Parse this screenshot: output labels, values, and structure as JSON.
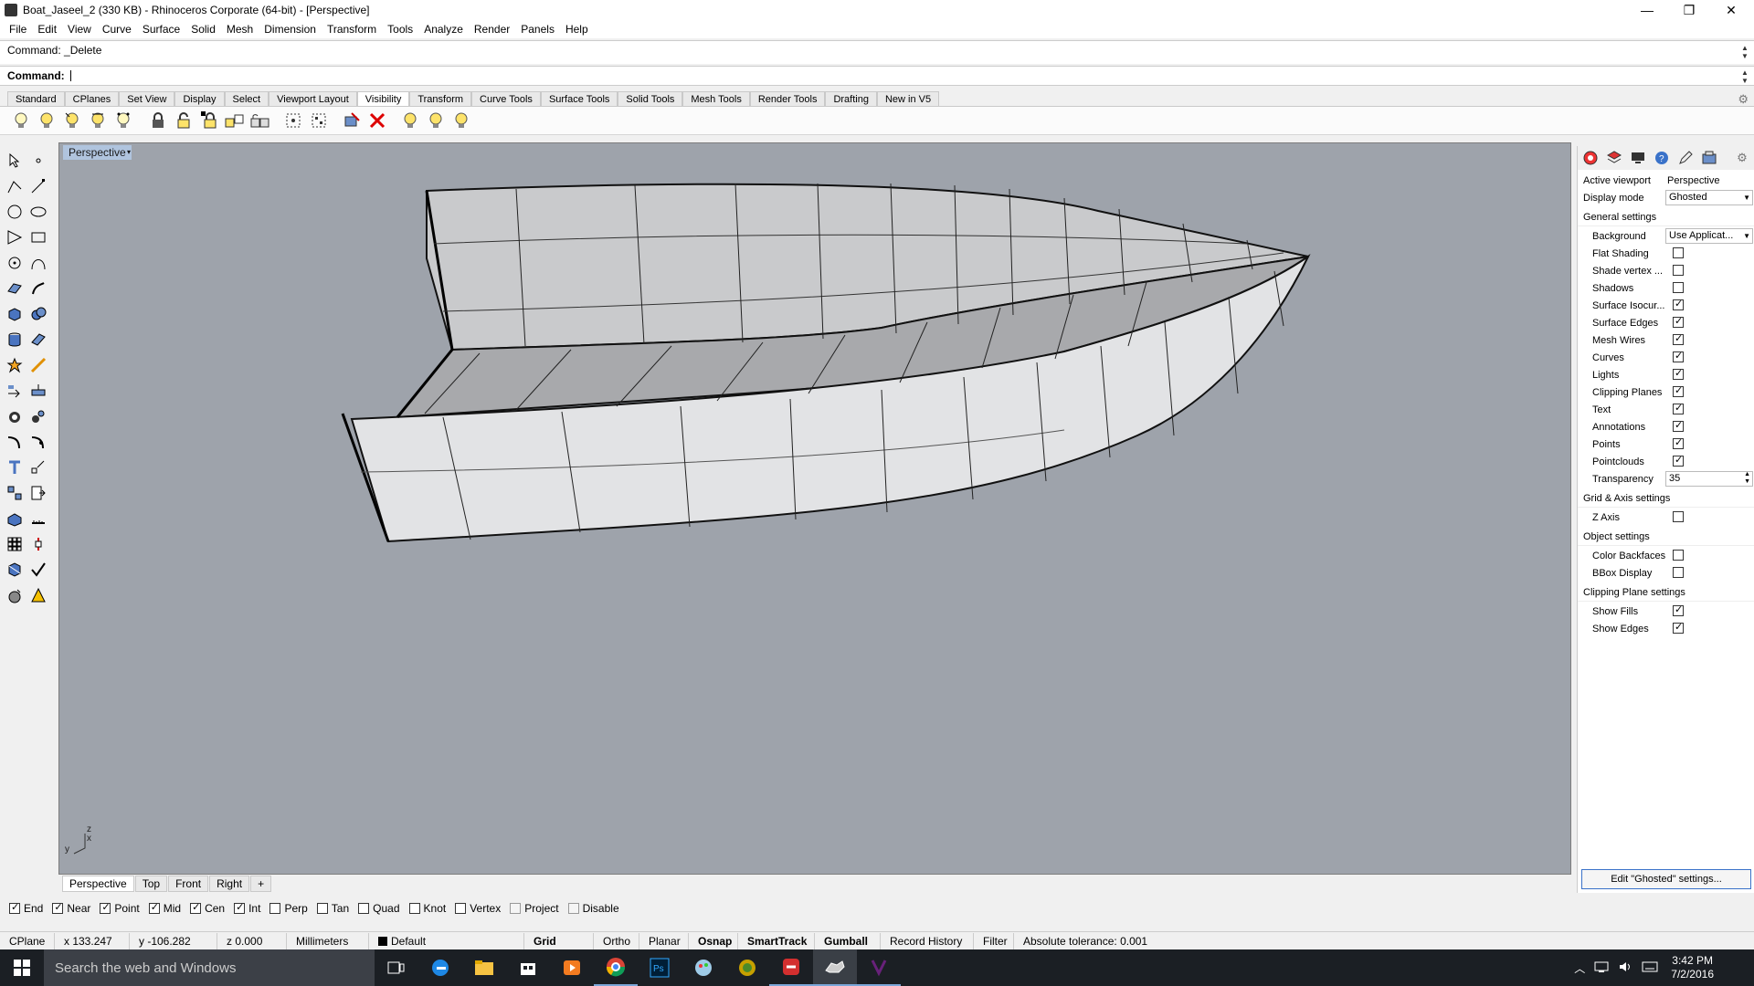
{
  "window": {
    "title": "Boat_Jaseel_2 (330 KB) - Rhinoceros Corporate (64-bit) - [Perspective]",
    "minimize": "—",
    "restore": "❐",
    "close": "✕"
  },
  "menu": [
    "File",
    "Edit",
    "View",
    "Curve",
    "Surface",
    "Solid",
    "Mesh",
    "Dimension",
    "Transform",
    "Tools",
    "Analyze",
    "Render",
    "Panels",
    "Help"
  ],
  "command": {
    "history": "Command: _Delete",
    "prompt": "Command:"
  },
  "toolbar_tabs": [
    "Standard",
    "CPlanes",
    "Set View",
    "Display",
    "Select",
    "Viewport Layout",
    "Visibility",
    "Transform",
    "Curve Tools",
    "Surface Tools",
    "Solid Tools",
    "Mesh Tools",
    "Render Tools",
    "Drafting",
    "New in V5"
  ],
  "active_toolbar_tab": "Visibility",
  "visibility_icons": [
    "bulb-icon",
    "bulb-icon",
    "bulb-icon",
    "bulb-icon",
    "bulb-icon",
    "lock-icon",
    "lock-icon",
    "lock-icon",
    "lock-icon",
    "lock-icon",
    "select-icon",
    "select-icon",
    "swap-icon",
    "delete-icon",
    "bulb-icon",
    "bulb-icon",
    "bulb-icon"
  ],
  "viewport": {
    "title": "Perspective",
    "arrow": "▾",
    "axis_z": "z",
    "axis_x": "x",
    "axis_y": "y"
  },
  "viewport_tabs": [
    "Perspective",
    "Top",
    "Front",
    "Right",
    "+"
  ],
  "osnap": [
    {
      "label": "End",
      "checked": true
    },
    {
      "label": "Near",
      "checked": true
    },
    {
      "label": "Point",
      "checked": true
    },
    {
      "label": "Mid",
      "checked": true
    },
    {
      "label": "Cen",
      "checked": true
    },
    {
      "label": "Int",
      "checked": true
    },
    {
      "label": "Perp",
      "checked": false
    },
    {
      "label": "Tan",
      "checked": false
    },
    {
      "label": "Quad",
      "checked": false
    },
    {
      "label": "Knot",
      "checked": false
    },
    {
      "label": "Vertex",
      "checked": false
    },
    {
      "label": "Project",
      "checked": false,
      "disabled": true
    },
    {
      "label": "Disable",
      "checked": false,
      "disabled": true
    }
  ],
  "status": {
    "cplane": "CPlane",
    "x": "x 133.247",
    "y": "y -106.282",
    "z": "z 0.000",
    "units": "Millimeters",
    "layer": "Default",
    "grid_snap": "Grid Snap",
    "ortho": "Ortho",
    "planar": "Planar",
    "osnap": "Osnap",
    "smarttrack": "SmartTrack",
    "gumball": "Gumball",
    "record_history": "Record History",
    "filter": "Filter",
    "tolerance": "Absolute tolerance: 0.001"
  },
  "panel": {
    "active_viewport_label": "Active viewport",
    "active_viewport_value": "Perspective",
    "display_mode_label": "Display mode",
    "display_mode_value": "Ghosted",
    "general_settings": "General settings",
    "background_label": "Background",
    "background_value": "Use Applicat...",
    "general_items": [
      {
        "label": "Flat Shading",
        "checked": false
      },
      {
        "label": "Shade vertex ...",
        "checked": false
      },
      {
        "label": "Shadows",
        "checked": false
      },
      {
        "label": "Surface Isocur...",
        "checked": true
      },
      {
        "label": "Surface Edges",
        "checked": true
      },
      {
        "label": "Mesh Wires",
        "checked": true
      },
      {
        "label": "Curves",
        "checked": true
      },
      {
        "label": "Lights",
        "checked": true
      },
      {
        "label": "Clipping Planes",
        "checked": true
      },
      {
        "label": "Text",
        "checked": true
      },
      {
        "label": "Annotations",
        "checked": true
      },
      {
        "label": "Points",
        "checked": true
      },
      {
        "label": "Pointclouds",
        "checked": true
      }
    ],
    "transparency_label": "Transparency",
    "transparency_value": "35",
    "grid_axis_settings": "Grid & Axis settings",
    "z_axis_label": "Z Axis",
    "z_axis_checked": false,
    "object_settings": "Object settings",
    "color_backfaces_label": "Color Backfaces",
    "color_backfaces_checked": false,
    "bbox_display_label": "BBox Display",
    "bbox_display_checked": false,
    "clipping_plane_settings": "Clipping Plane settings",
    "show_fills_label": "Show Fills",
    "show_fills_checked": true,
    "show_edges_label": "Show Edges",
    "show_edges_checked": true,
    "edit_button": "Edit \"Ghosted\" settings..."
  },
  "taskbar": {
    "search_placeholder": "Search the web and Windows",
    "apps": [
      "task-view-icon",
      "edge-icon",
      "file-explorer-icon",
      "store-icon",
      "media-icon",
      "chrome-icon",
      "photoshop-icon",
      "app-icon",
      "app-icon",
      "rhino-icon",
      "app-icon",
      "app-icon"
    ],
    "time": "3:42 PM",
    "date": "7/2/2016"
  },
  "colors": {
    "viewport_bg": "#9ea3ab",
    "viewport_title_bg": "#b0c4de",
    "taskbar_bg": "#1b1f24",
    "accent": "#3a72c9"
  }
}
